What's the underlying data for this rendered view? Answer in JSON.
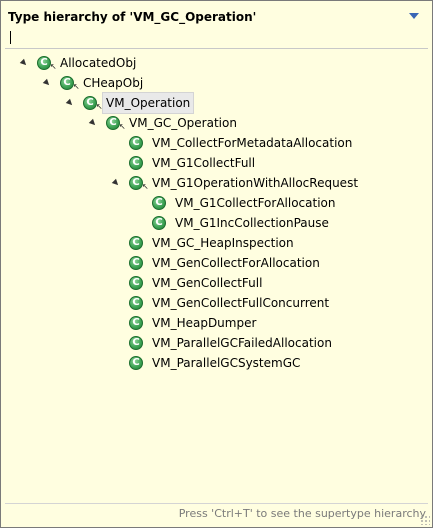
{
  "header": {
    "title": "Type hierarchy of 'VM_GC_Operation'",
    "menu_icon": "chevron-down-icon"
  },
  "filter": {
    "value": ""
  },
  "tree": {
    "items": [
      {
        "label": "AllocatedObj",
        "depth": 0,
        "expanded": true,
        "selected": false,
        "icon": "class-icon"
      },
      {
        "label": "CHeapObj",
        "depth": 1,
        "expanded": true,
        "selected": false,
        "icon": "class-icon"
      },
      {
        "label": "VM_Operation",
        "depth": 2,
        "expanded": true,
        "selected": true,
        "icon": "class-icon"
      },
      {
        "label": "VM_GC_Operation",
        "depth": 3,
        "expanded": true,
        "selected": false,
        "icon": "class-icon"
      },
      {
        "label": "VM_CollectForMetadataAllocation",
        "depth": 4,
        "expanded": null,
        "selected": false,
        "icon": "class-icon"
      },
      {
        "label": "VM_G1CollectFull",
        "depth": 4,
        "expanded": null,
        "selected": false,
        "icon": "class-icon"
      },
      {
        "label": "VM_G1OperationWithAllocRequest",
        "depth": 4,
        "expanded": true,
        "selected": false,
        "icon": "class-icon"
      },
      {
        "label": "VM_G1CollectForAllocation",
        "depth": 5,
        "expanded": null,
        "selected": false,
        "icon": "class-icon"
      },
      {
        "label": "VM_G1IncCollectionPause",
        "depth": 5,
        "expanded": null,
        "selected": false,
        "icon": "class-icon"
      },
      {
        "label": "VM_GC_HeapInspection",
        "depth": 4,
        "expanded": null,
        "selected": false,
        "icon": "class-icon"
      },
      {
        "label": "VM_GenCollectForAllocation",
        "depth": 4,
        "expanded": null,
        "selected": false,
        "icon": "class-icon"
      },
      {
        "label": "VM_GenCollectFull",
        "depth": 4,
        "expanded": null,
        "selected": false,
        "icon": "class-icon"
      },
      {
        "label": "VM_GenCollectFullConcurrent",
        "depth": 4,
        "expanded": null,
        "selected": false,
        "icon": "class-icon"
      },
      {
        "label": "VM_HeapDumper",
        "depth": 4,
        "expanded": null,
        "selected": false,
        "icon": "class-icon"
      },
      {
        "label": "VM_ParallelGCFailedAllocation",
        "depth": 4,
        "expanded": null,
        "selected": false,
        "icon": "class-icon"
      },
      {
        "label": "VM_ParallelGCSystemGC",
        "depth": 4,
        "expanded": null,
        "selected": false,
        "icon": "class-icon"
      }
    ]
  },
  "footer": {
    "hint": "Press 'Ctrl+T' to see the supertype hierarchy"
  },
  "colors": {
    "background": "#fffee0",
    "class_icon": "#3ea455",
    "menu_arrow": "#3a66b5"
  }
}
